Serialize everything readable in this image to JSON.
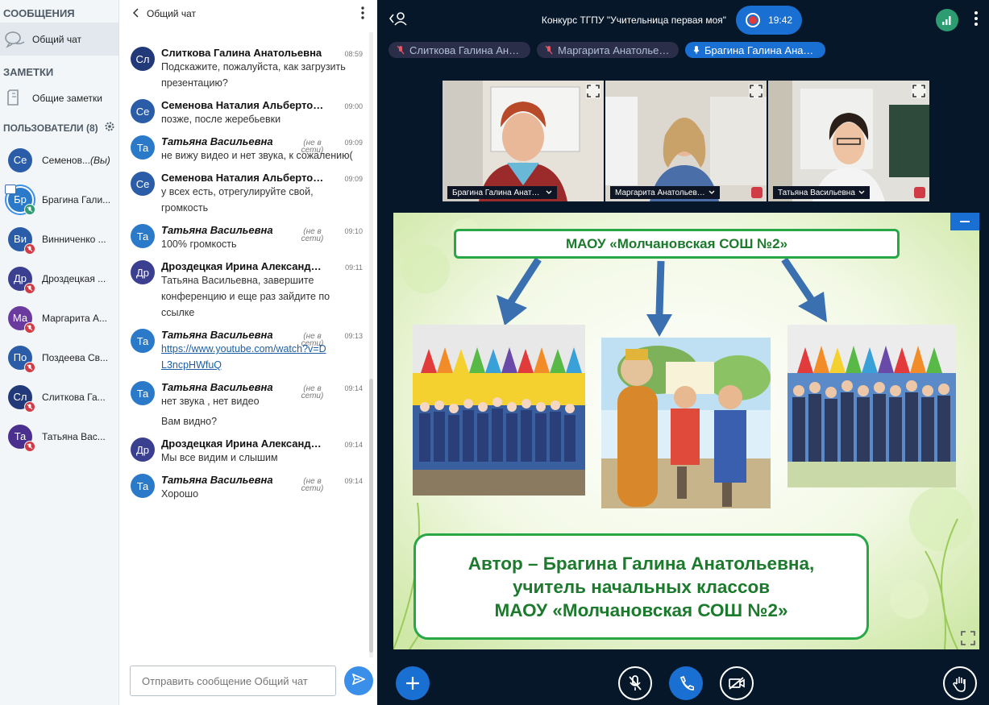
{
  "sidebar": {
    "messages_title": "СООБЩЕНИЯ",
    "public_chat": "Общий чат",
    "notes_title": "ЗАМЕТКИ",
    "shared_notes": "Общие заметки",
    "users_title": "ПОЛЬЗОВАТЕЛИ (8)",
    "users": [
      {
        "initials": "Се",
        "name": "Семенов...",
        "you": "(Вы)",
        "color": "#2A5CA8"
      },
      {
        "initials": "Бр",
        "name": "Брагина Гали...",
        "color": "#2A7AC9"
      },
      {
        "initials": "Ви",
        "name": "Винниченко ...",
        "color": "#2A5CA8"
      },
      {
        "initials": "Др",
        "name": "Дроздецкая ...",
        "color": "#3B3F8F"
      },
      {
        "initials": "Ма",
        "name": "Маргарита А...",
        "color": "#6B3A9E"
      },
      {
        "initials": "По",
        "name": "Поздеева Св...",
        "color": "#2A5CA8"
      },
      {
        "initials": "Сл",
        "name": "Слиткова Га...",
        "color": "#233A7A"
      },
      {
        "initials": "Та",
        "name": "Татьяна Вас...",
        "color": "#4A2F8F"
      }
    ]
  },
  "chat": {
    "title": "Общий чат",
    "offline_label": "(не в сети)",
    "messages": [
      {
        "initials": "Сл",
        "color": "#233A7A",
        "name": "Слиткова Галина Анатольевна",
        "time": "08:59",
        "lines": [
          "Подскажите, пожалуйста, как загрузить презентацию?"
        ]
      },
      {
        "initials": "Се",
        "color": "#2A5CA8",
        "name": "Семенова Наталия Альбертовна",
        "time": "09:00",
        "lines": [
          "позже, после жеребьевки"
        ]
      },
      {
        "initials": "Та",
        "color": "#2A7AC9",
        "name": "Татьяна Васильевна",
        "offline": true,
        "time": "09:09",
        "lines": [
          "не вижу видео и нет звука, к сожалению("
        ]
      },
      {
        "initials": "Се",
        "color": "#2A5CA8",
        "name": "Семенова Наталия Альбертовна",
        "time": "09:09",
        "lines": [
          "у всех есть, отрегулируйте свой, громкость"
        ]
      },
      {
        "initials": "Та",
        "color": "#2A7AC9",
        "name": "Татьяна Васильевна",
        "offline": true,
        "time": "09:10",
        "lines": [
          "100% громкость"
        ]
      },
      {
        "initials": "Др",
        "color": "#3B3F8F",
        "name": "Дроздецкая Ирина Александровна",
        "time": "09:11",
        "lines": [
          "Татьяна Васильевна, завершите конференцию и еще раз зайдите по ссылке"
        ]
      },
      {
        "initials": "Та",
        "color": "#2A7AC9",
        "name": "Татьяна Васильевна",
        "offline": true,
        "time": "09:13",
        "link": "https://www.youtube.com/watch?v=DL3ncpHWfuQ"
      },
      {
        "initials": "Та",
        "color": "#2A7AC9",
        "name": "Татьяна Васильевна",
        "offline": true,
        "time": "09:14",
        "lines": [
          "нет звука , нет видео",
          "Вам видно?"
        ]
      },
      {
        "initials": "Др",
        "color": "#3B3F8F",
        "name": "Дроздецкая Ирина Александровна",
        "time": "09:14",
        "lines": [
          "Мы все видим и слышим"
        ]
      },
      {
        "initials": "Та",
        "color": "#2A7AC9",
        "name": "Татьяна Васильевна",
        "offline": true,
        "time": "09:14",
        "lines": [
          "Хорошо"
        ]
      }
    ],
    "input_placeholder": "Отправить сообщение Общий чат"
  },
  "top_bar": {
    "title": "Конкурс ТГПУ \"Учительница первая моя\"",
    "rec_time": "19:42"
  },
  "speakers": [
    {
      "name": "Слиткова Галина Анатольевна",
      "active": false
    },
    {
      "name": "Маргарита Анатольевна",
      "active": false
    },
    {
      "name": "Брагина Галина Анатольевна",
      "active": true
    }
  ],
  "videos": [
    {
      "label": "Брагина Галина Анатольевна",
      "muted": false,
      "selected": true
    },
    {
      "label": "Маргарита Анатольевна",
      "muted": true,
      "selected": false
    },
    {
      "label": "Татьяна Васильевна",
      "muted": true,
      "selected": false
    }
  ],
  "slide": {
    "headline": "МАОУ «Молчановская СОШ №2»",
    "author_lines": [
      "Автор – Брагина Галина Анатольевна,",
      "учитель начальных классов",
      "МАОУ «Молчановская СОШ №2»"
    ]
  },
  "colors": {
    "accent": "#1A6FD3",
    "muted_red": "#D13B46",
    "slide_green": "#27A745",
    "text_green": "#1C7A2C"
  }
}
